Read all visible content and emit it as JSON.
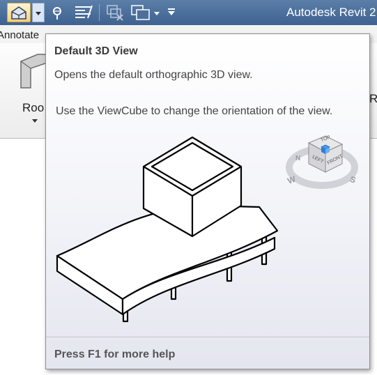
{
  "app": {
    "title": "Autodesk Revit 2"
  },
  "quick_access_toolbar": {
    "items": [
      {
        "name": "default-3d-view",
        "icon": "house-3d-icon",
        "active": true
      },
      {
        "name": "3d-view-dropdown",
        "icon": "chevron-down-icon"
      },
      {
        "name": "close-hidden-windows",
        "icon": "close-hidden-windows-icon"
      },
      {
        "name": "thin-lines",
        "icon": "thin-lines-icon"
      },
      {
        "name": "close-inactive-views",
        "icon": "close-views-icon"
      },
      {
        "name": "switch-windows",
        "icon": "switch-windows-icon"
      },
      {
        "name": "customize",
        "icon": "chevron-down-icon"
      }
    ]
  },
  "ribbon": {
    "tabs": [
      "Annotate"
    ],
    "right_fragment": "Ra",
    "panel": {
      "roof_label": "Roo"
    }
  },
  "tooltip": {
    "title": "Default 3D View",
    "description": "Opens the default orthographic 3D view.",
    "detail": "Use the ViewCube to change the orientation of the view.",
    "help": "Press F1 for more help",
    "viewcube": {
      "top": "TOP",
      "left": "LEFT",
      "front": "FRONT",
      "compass": [
        "N",
        "W",
        "S"
      ]
    }
  },
  "colors": {
    "titlebar": "#4a6e9a",
    "accent": "#3a8de0"
  }
}
